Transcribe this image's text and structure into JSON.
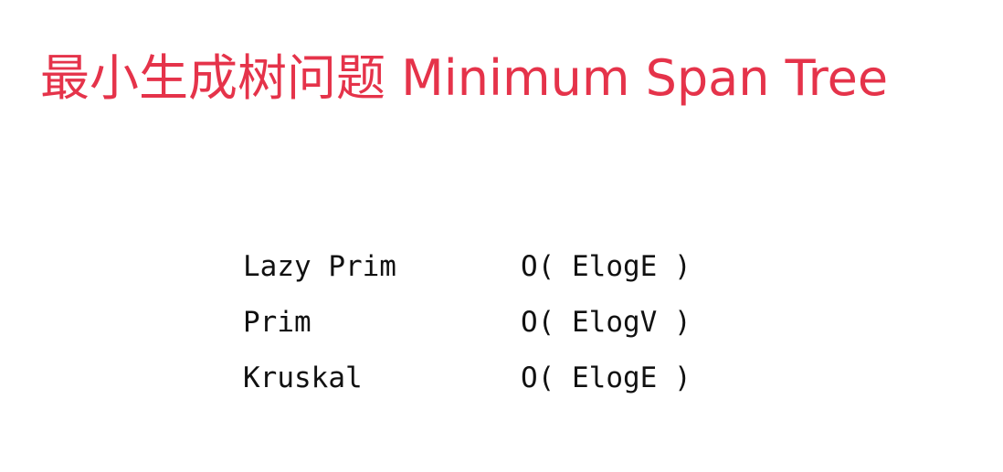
{
  "slide": {
    "title": "最小生成树问题 Minimum Span Tree",
    "title_color": "#e5334a"
  },
  "table": {
    "rows": [
      {
        "algorithm": "Lazy Prim",
        "complexity": "O( ElogE )"
      },
      {
        "algorithm": "Prim",
        "complexity": "O( ElogV )"
      },
      {
        "algorithm": "Kruskal",
        "complexity": "O( ElogE )"
      }
    ]
  }
}
